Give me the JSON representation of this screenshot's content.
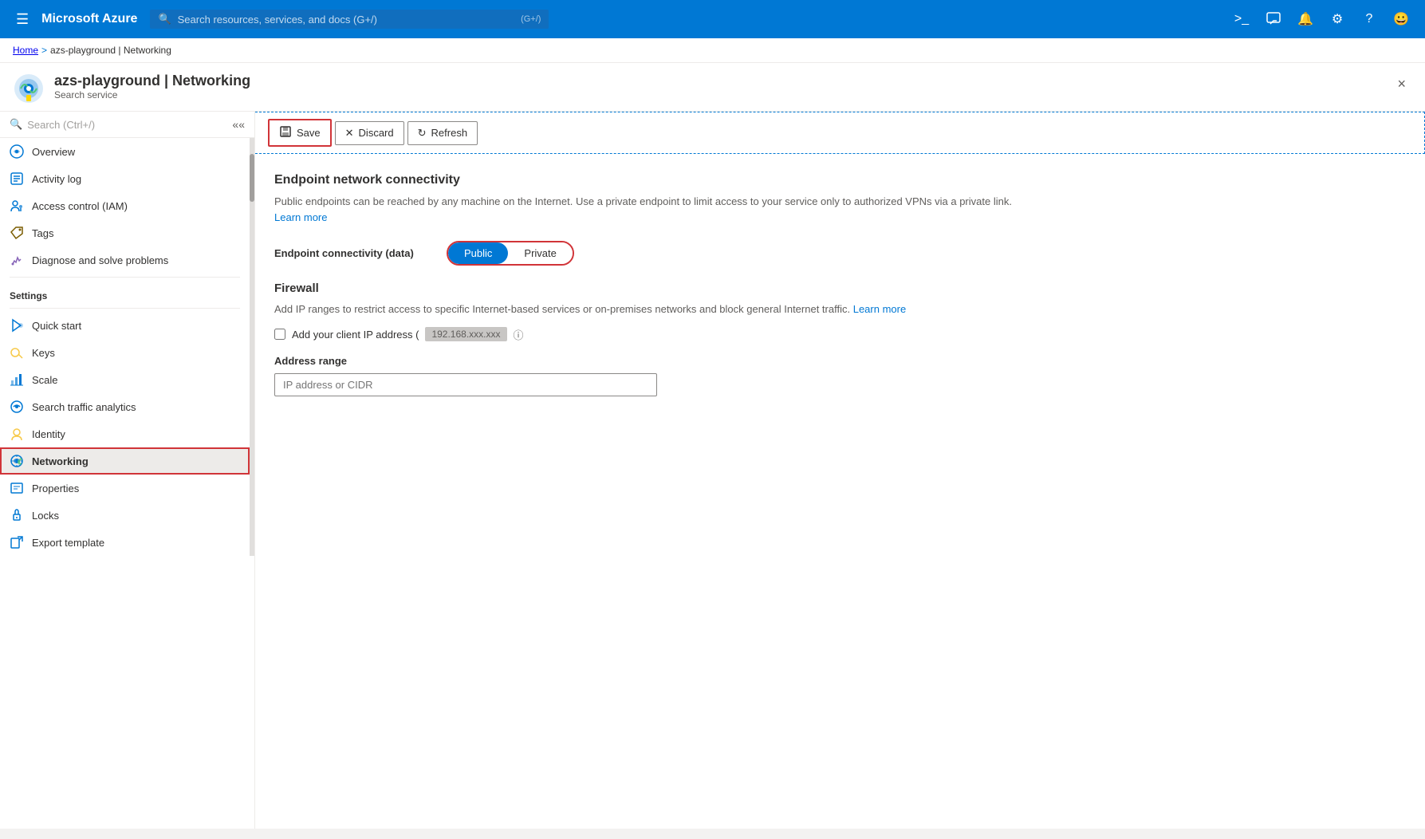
{
  "topbar": {
    "brand": "Microsoft Azure",
    "search_placeholder": "Search resources, services, and docs (G+/)",
    "icons": [
      "terminal",
      "feedback",
      "bell",
      "settings",
      "help",
      "smiley"
    ]
  },
  "breadcrumb": {
    "home": "Home",
    "separator": ">",
    "current": "azs-playground | Networking"
  },
  "page_header": {
    "title": "azs-playground | Networking",
    "subtitle": "Search service",
    "close_label": "×"
  },
  "sidebar": {
    "search_placeholder": "Search (Ctrl+/)",
    "nav_items": [
      {
        "id": "overview",
        "label": "Overview",
        "icon": "cloud"
      },
      {
        "id": "activity-log",
        "label": "Activity log",
        "icon": "list"
      },
      {
        "id": "access-control",
        "label": "Access control (IAM)",
        "icon": "people"
      },
      {
        "id": "tags",
        "label": "Tags",
        "icon": "tag"
      },
      {
        "id": "diagnose",
        "label": "Diagnose and solve problems",
        "icon": "wrench"
      }
    ],
    "settings_label": "Settings",
    "settings_items": [
      {
        "id": "quickstart",
        "label": "Quick start",
        "icon": "rocket"
      },
      {
        "id": "keys",
        "label": "Keys",
        "icon": "key"
      },
      {
        "id": "scale",
        "label": "Scale",
        "icon": "chart"
      },
      {
        "id": "search-traffic",
        "label": "Search traffic analytics",
        "icon": "analytics"
      },
      {
        "id": "identity",
        "label": "Identity",
        "icon": "identity"
      },
      {
        "id": "networking",
        "label": "Networking",
        "icon": "network",
        "active": true
      },
      {
        "id": "properties",
        "label": "Properties",
        "icon": "properties"
      },
      {
        "id": "locks",
        "label": "Locks",
        "icon": "lock"
      },
      {
        "id": "export",
        "label": "Export template",
        "icon": "export"
      }
    ]
  },
  "toolbar": {
    "save_label": "Save",
    "discard_label": "Discard",
    "refresh_label": "Refresh"
  },
  "content": {
    "endpoint_title": "Endpoint network connectivity",
    "endpoint_description": "Public endpoints can be reached by any machine on the Internet. Use a private endpoint to limit access to your service only to authorized VPNs via a private link.",
    "learn_more_label": "Learn more",
    "endpoint_connectivity_label": "Endpoint connectivity (data)",
    "public_label": "Public",
    "private_label": "Private",
    "firewall_title": "Firewall",
    "firewall_description": "Add IP ranges to restrict access to specific Internet-based services or on-premises networks and block general Internet traffic.",
    "firewall_learn_more": "Learn more",
    "checkbox_label": "Add your client IP address (",
    "ip_address": "192.168.xxx.xxx",
    "address_range_label": "Address range",
    "address_placeholder": "IP address or CIDR"
  }
}
